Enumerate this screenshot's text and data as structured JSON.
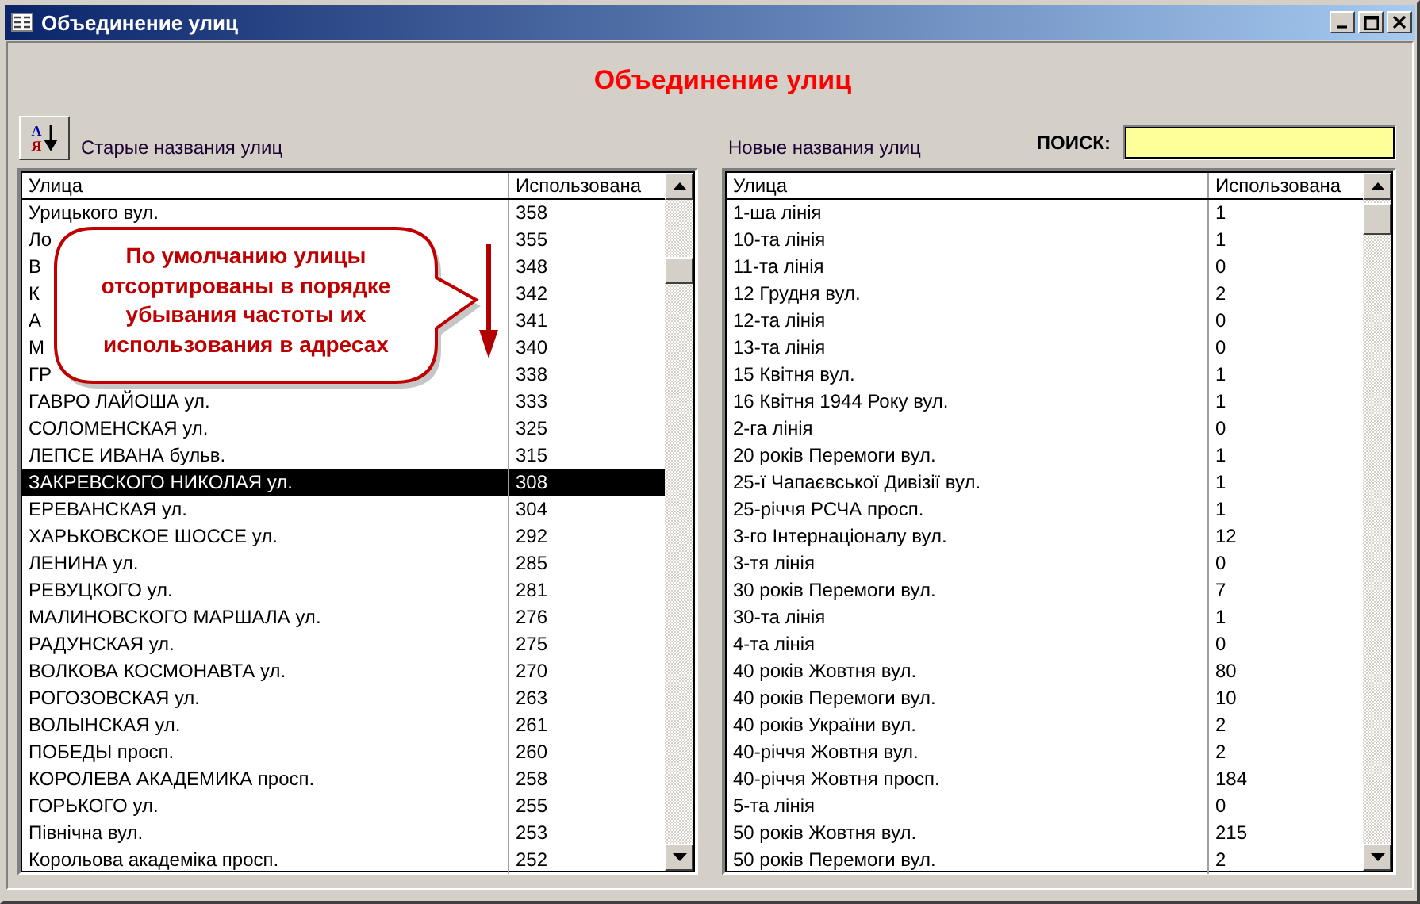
{
  "window": {
    "title": "Объединение улиц"
  },
  "heading": "Объединение улиц",
  "sort_button": {
    "top_letter": "А",
    "bottom_letter": "Я"
  },
  "left_list": {
    "label": "Старые названия улиц",
    "columns": [
      "Улица",
      "Использована"
    ],
    "rows": [
      {
        "street": "Урицького вул.",
        "count": "358",
        "selected": false
      },
      {
        "street": "Ло",
        "count": "355",
        "selected": false
      },
      {
        "street": "В",
        "count": "348",
        "selected": false
      },
      {
        "street": "К",
        "count": "342",
        "selected": false
      },
      {
        "street": "А",
        "count": "341",
        "selected": false
      },
      {
        "street": "М",
        "count": "340",
        "selected": false
      },
      {
        "street": "ГР",
        "count": "338",
        "selected": false
      },
      {
        "street": "ГАВРО ЛАЙОША ул.",
        "count": "333",
        "selected": false
      },
      {
        "street": "СОЛОМЕНСКАЯ ул.",
        "count": "325",
        "selected": false
      },
      {
        "street": "ЛЕПСЕ ИВАНА бульв.",
        "count": "315",
        "selected": false
      },
      {
        "street": "ЗАКРЕВСКОГО НИКОЛАЯ ул.",
        "count": "308",
        "selected": true
      },
      {
        "street": "ЕРЕВАНСКАЯ ул.",
        "count": "304",
        "selected": false
      },
      {
        "street": "ХАРЬКОВСКОЕ ШОССЕ ул.",
        "count": "292",
        "selected": false
      },
      {
        "street": "ЛЕНИНА ул.",
        "count": "285",
        "selected": false
      },
      {
        "street": "РЕВУЦКОГО ул.",
        "count": "281",
        "selected": false
      },
      {
        "street": "МАЛИНОВСКОГО МАРШАЛА ул.",
        "count": "276",
        "selected": false
      },
      {
        "street": "РАДУНСКАЯ ул.",
        "count": "275",
        "selected": false
      },
      {
        "street": "ВОЛКОВА КОСМОНАВТА ул.",
        "count": "270",
        "selected": false
      },
      {
        "street": "РОГОЗОВСКАЯ ул.",
        "count": "263",
        "selected": false
      },
      {
        "street": "ВОЛЫНСКАЯ ул.",
        "count": "261",
        "selected": false
      },
      {
        "street": "ПОБЕДЫ просп.",
        "count": "260",
        "selected": false
      },
      {
        "street": "КОРОЛЕВА АКАДЕМИКА просп.",
        "count": "258",
        "selected": false
      },
      {
        "street": "ГОРЬКОГО ул.",
        "count": "255",
        "selected": false
      },
      {
        "street": "Північна вул.",
        "count": "253",
        "selected": false
      },
      {
        "street": "Корольова академіка просп.",
        "count": "252",
        "selected": false
      }
    ]
  },
  "search": {
    "label": "ПОИСК:"
  },
  "right_list": {
    "label": "Новые названия улиц",
    "columns": [
      "Улица",
      "Использована"
    ],
    "rows": [
      {
        "street": "1-ша лінія",
        "count": "1",
        "selected": false
      },
      {
        "street": "10-та лінія",
        "count": "1",
        "selected": false
      },
      {
        "street": "11-та лінія",
        "count": "0",
        "selected": false
      },
      {
        "street": "12 Грудня вул.",
        "count": "2",
        "selected": false
      },
      {
        "street": "12-та лінія",
        "count": "0",
        "selected": false
      },
      {
        "street": "13-та лінія",
        "count": "0",
        "selected": false
      },
      {
        "street": "15 Квітня вул.",
        "count": "1",
        "selected": false
      },
      {
        "street": "16 Квітня 1944 Року вул.",
        "count": "1",
        "selected": false
      },
      {
        "street": "2-га лінія",
        "count": "0",
        "selected": false
      },
      {
        "street": "20 років Перемоги вул.",
        "count": "1",
        "selected": false
      },
      {
        "street": "25-ї Чапаєвської Дивізії вул.",
        "count": "1",
        "selected": false
      },
      {
        "street": "25-річчя РСЧА просп.",
        "count": "1",
        "selected": false
      },
      {
        "street": "3-го Інтернаціоналу вул.",
        "count": "12",
        "selected": false
      },
      {
        "street": "3-тя лінія",
        "count": "0",
        "selected": false
      },
      {
        "street": "30 років Перемоги вул.",
        "count": "7",
        "selected": false
      },
      {
        "street": "30-та лінія",
        "count": "1",
        "selected": false
      },
      {
        "street": "4-та лінія",
        "count": "0",
        "selected": false
      },
      {
        "street": "40 років Жовтня вул.",
        "count": "80",
        "selected": false
      },
      {
        "street": "40 років Перемоги вул.",
        "count": "10",
        "selected": false
      },
      {
        "street": "40 років України вул.",
        "count": "2",
        "selected": false
      },
      {
        "street": "40-річчя Жовтня вул.",
        "count": "2",
        "selected": false
      },
      {
        "street": "40-річчя Жовтня просп.",
        "count": "184",
        "selected": false
      },
      {
        "street": "5-та лінія",
        "count": "0",
        "selected": false
      },
      {
        "street": "50 років Жовтня вул.",
        "count": "215",
        "selected": false
      },
      {
        "street": "50 років Перемоги вул.",
        "count": "2",
        "selected": false
      }
    ]
  },
  "callout": {
    "text": "По умолчанию улицы отсортированы в порядке убывания частоты их использования в адресах"
  }
}
